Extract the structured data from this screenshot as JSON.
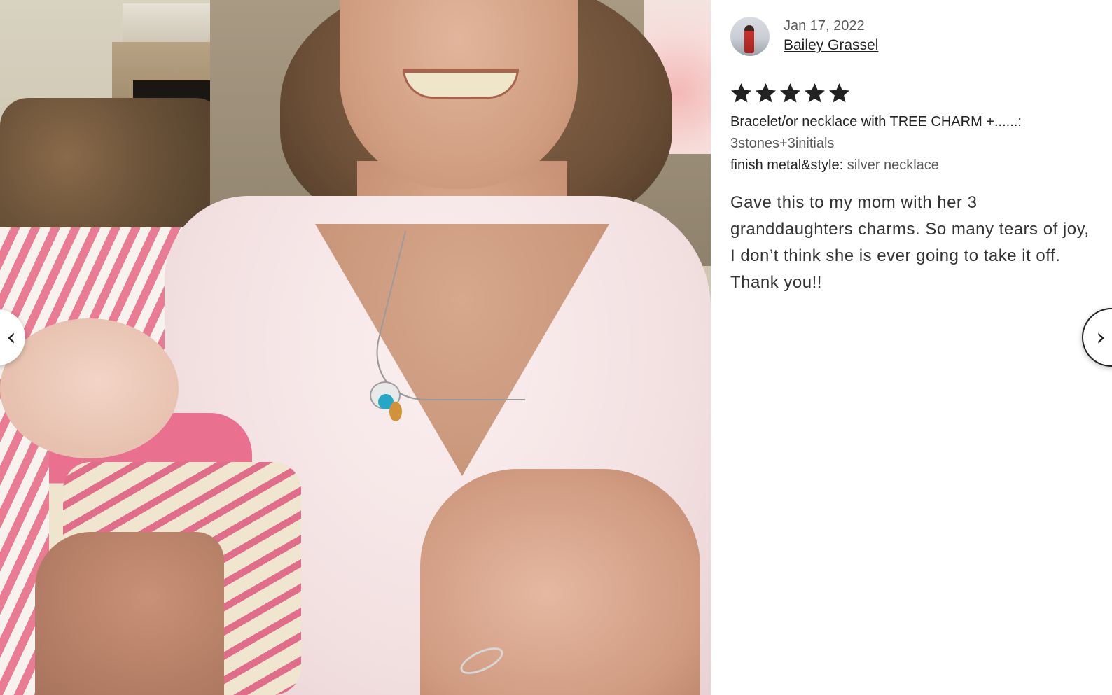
{
  "review": {
    "date": "Jan 17, 2022",
    "reviewer_name": "Bailey Grassel",
    "rating": 5,
    "rating_max": 5,
    "variations": [
      {
        "label": "Bracelet/or necklace with TREE CHARM +......:",
        "value": "3stones+3initials"
      },
      {
        "label": "finish metal&style:",
        "value": "silver necklace"
      }
    ],
    "text": "Gave this to my mom with her 3 granddaughters charms. So many tears of joy, I don’t think she is ever going to take it off. Thank you!!"
  },
  "navigation": {
    "prev_icon": "chevron-left-icon",
    "next_icon": "chevron-right-icon",
    "prev_glyph": "‹",
    "next_glyph": "›"
  },
  "photo": {
    "description_icon": "review-photo"
  },
  "colors": {
    "star": "#222222",
    "text": "#222222",
    "muted_text": "#595959"
  }
}
